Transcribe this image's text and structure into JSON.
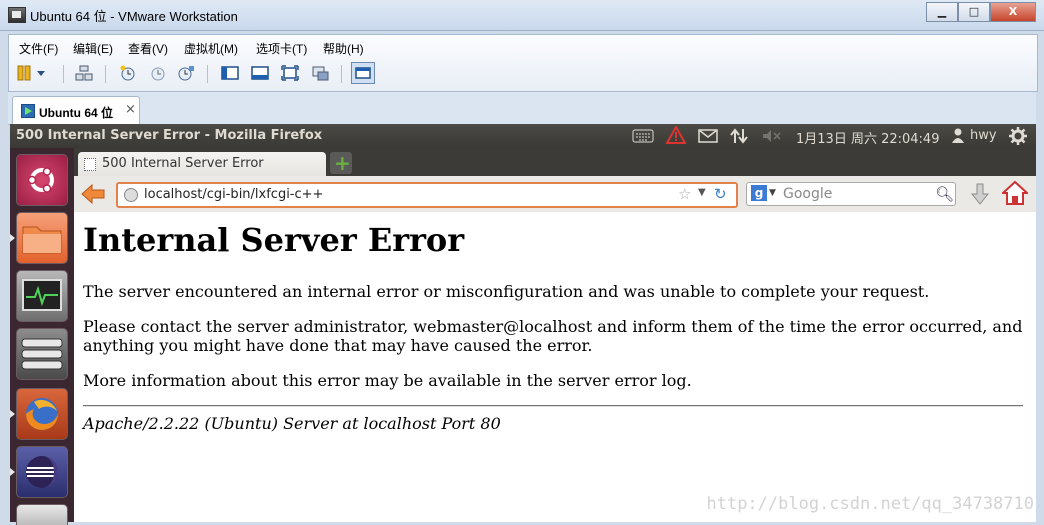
{
  "vmware": {
    "window_title": "Ubuntu 64 位 - VMware Workstation",
    "window_buttons": {
      "minimize": "▁",
      "maximize": "□",
      "close": "X"
    },
    "menu": [
      "文件(F)",
      "编辑(E)",
      "查看(V)",
      "虚拟机(M)",
      "选项卡(T)",
      "帮助(H)"
    ],
    "tab_label": "Ubuntu 64 位",
    "tab_close": "×"
  },
  "ubuntu_panel": {
    "window_title": "500 Internal Server Error - Mozilla Firefox",
    "datetime": "1月13日 周六 22:04:49",
    "user": "hwy"
  },
  "firefox": {
    "tab_title": "500 Internal Server Error",
    "new_tab": "+",
    "url": "localhost/cgi-bin/lxfcgi-c++",
    "search_placeholder": "Google",
    "search_engine_letter": "g"
  },
  "page": {
    "heading": "Internal Server Error",
    "para1": "The server encountered an internal error or misconfiguration and was unable to complete your request.",
    "para2": "Please contact the server administrator, webmaster@localhost and inform them of the time the error occurred, and anything you might have done that may have caused the error.",
    "para3": "More information about this error may be available in the server error log.",
    "address": "Apache/2.2.22 (Ubuntu) Server at localhost Port 80"
  },
  "watermark": "http://blog.csdn.net/qq_34738710"
}
